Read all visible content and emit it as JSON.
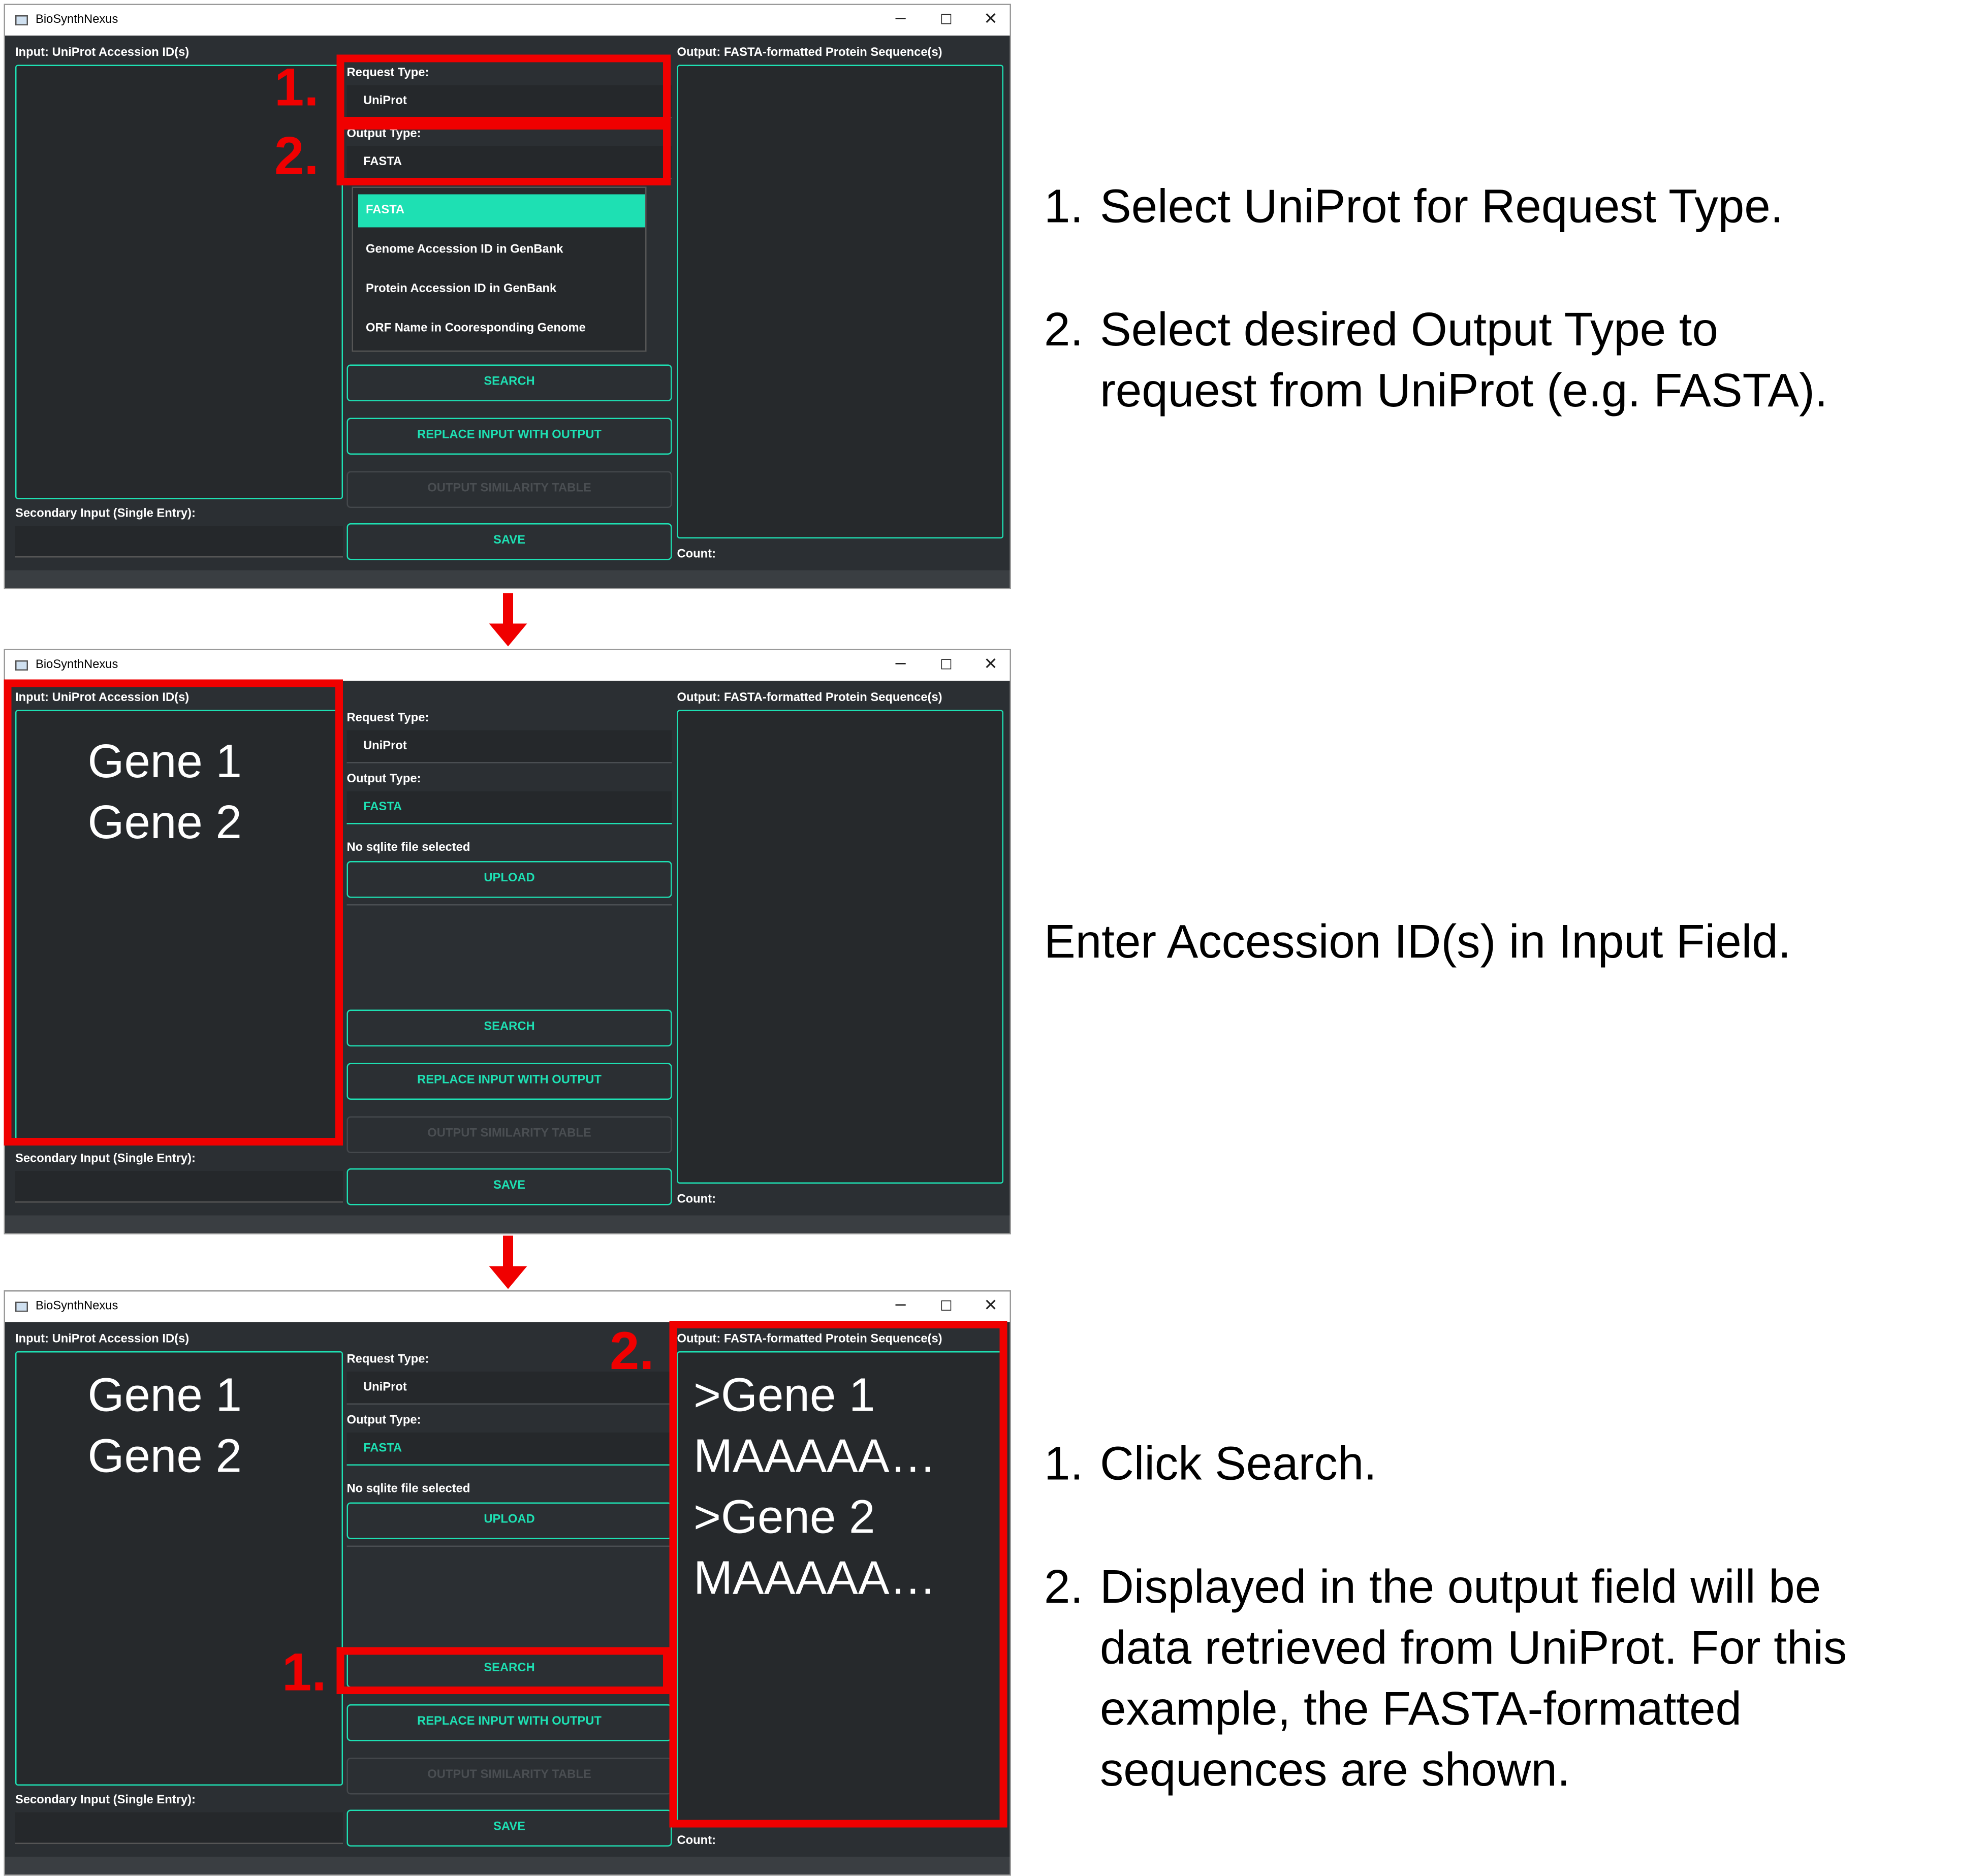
{
  "window": {
    "title": "BioSynthNexus",
    "controls": {
      "minimize": "─",
      "maximize": "☐",
      "close": "✕"
    }
  },
  "labels": {
    "input": "Input: UniProt Accession ID(s)",
    "output": "Output: FASTA-formatted Protein Sequence(s)",
    "request_type": "Request Type:",
    "output_type": "Output Type:",
    "secondary_input": "Secondary Input (Single Entry):",
    "count": "Count:",
    "sqlite_status": "No sqlite file selected"
  },
  "values": {
    "request_type": "UniProt",
    "output_type": "FASTA"
  },
  "dropdown_options": [
    "FASTA",
    "Genome Accession ID in GenBank",
    "Protein Accession ID in GenBank",
    "ORF Name in Cooresponding Genome"
  ],
  "buttons": {
    "search": "SEARCH",
    "replace": "REPLACE INPUT WITH OUTPUT",
    "similarity": "OUTPUT SIMILARITY TABLE",
    "save": "SAVE",
    "upload": "UPLOAD"
  },
  "input_text": [
    "Gene 1",
    "Gene 2"
  ],
  "output_text": [
    ">Gene 1",
    "MAAAAA…",
    ">Gene 2",
    "MAAAAA…"
  ],
  "markers": {
    "one": "1.",
    "two": "2."
  },
  "steps": {
    "panel1": {
      "n1": "1.",
      "s1": "Select UniProt for Request Type.",
      "n2": "2.",
      "s2_line1": "Select desired Output Type to",
      "s2_line2": "request from UniProt (e.g. FASTA)."
    },
    "panel2": {
      "s1": "Enter Accession ID(s) in Input Field."
    },
    "panel3": {
      "n1": "1.",
      "s1": "Click Search.",
      "n2": "2.",
      "s2_line1": "Displayed in the output field will be",
      "s2_line2": "data retrieved from UniProt. For this",
      "s2_line3": "example, the FASTA-formatted",
      "s2_line4": "sequences are shown."
    }
  },
  "colors": {
    "accent": "#1ee0b3",
    "background": "#2b2f33",
    "highlight": "#f00000"
  }
}
